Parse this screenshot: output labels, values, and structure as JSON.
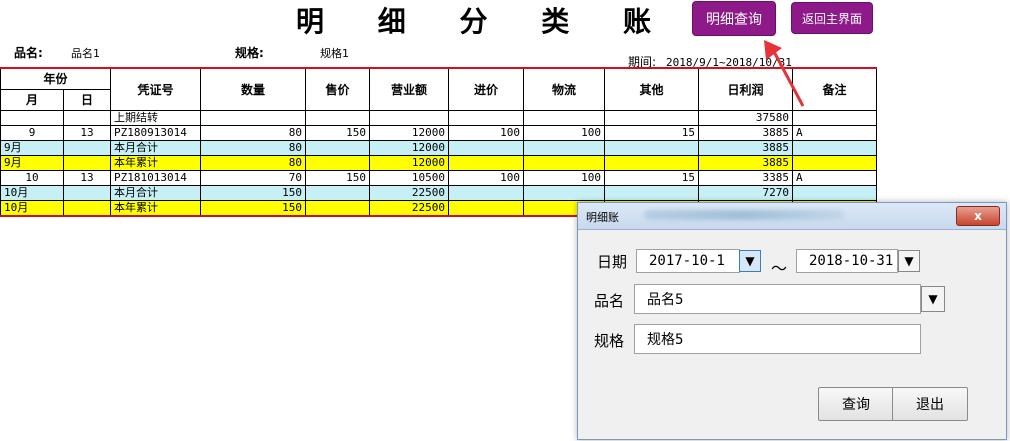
{
  "title": "明 细 分 类 账",
  "buttons": {
    "detail_query": "明细查询",
    "back_main": "返回主界面"
  },
  "info": {
    "product_label": "品名:",
    "product_value": "品名1",
    "spec_label": "规格:",
    "spec_value": "规格1",
    "period_label": "期间:",
    "period_value": "2018/9/1~2018/10/31"
  },
  "table": {
    "headers": {
      "year": "年份",
      "month": "月",
      "day": "日",
      "voucher": "凭证号",
      "quantity": "数量",
      "price": "售价",
      "revenue": "营业额",
      "cost": "进价",
      "logistics": "物流",
      "other": "其他",
      "daily_profit": "日利润",
      "remark": "备注"
    },
    "rows": [
      {
        "type": "normal",
        "cells": [
          "",
          "",
          "上期结转",
          "",
          "",
          "",
          "",
          "",
          "",
          "37580",
          ""
        ]
      },
      {
        "type": "normal",
        "cells": [
          "9",
          "13",
          "PZ180913014",
          "80",
          "150",
          "12000",
          "100",
          "100",
          "15",
          "3885",
          "A"
        ]
      },
      {
        "type": "month",
        "cells": [
          "9月",
          "",
          "本月合计",
          "80",
          "",
          "12000",
          "",
          "",
          "",
          "3885",
          ""
        ]
      },
      {
        "type": "year",
        "cells": [
          "9月",
          "",
          "本年累计",
          "80",
          "",
          "12000",
          "",
          "",
          "",
          "3885",
          ""
        ]
      },
      {
        "type": "normal",
        "cells": [
          "10",
          "13",
          "PZ181013014",
          "70",
          "150",
          "10500",
          "100",
          "100",
          "15",
          "3385",
          "A"
        ]
      },
      {
        "type": "month",
        "cells": [
          "10月",
          "",
          "本月合计",
          "150",
          "",
          "22500",
          "",
          "",
          "",
          "7270",
          ""
        ]
      },
      {
        "type": "year",
        "cells": [
          "10月",
          "",
          "本年累计",
          "150",
          "",
          "22500",
          "",
          "",
          "",
          "",
          ""
        ]
      }
    ]
  },
  "dialog": {
    "title": "明细账",
    "close": "x",
    "date_label": "日期",
    "date_from": "2017-10-1",
    "tilde": "～",
    "date_to": "2018-10-31",
    "product_label": "品名",
    "product_value": "品名5",
    "spec_label": "规格",
    "spec_value": "规格5",
    "query": "查询",
    "exit": "退出"
  },
  "icons": {
    "dropdown": "dropdown-arrow-icon",
    "annotation": "red-arrow-icon"
  },
  "colors": {
    "button_purple": "#8e1a8a",
    "month_row": "#c7f0f6",
    "year_row": "#ffff00",
    "rule_red": "#d01020",
    "annotation_red": "#e8323a"
  }
}
